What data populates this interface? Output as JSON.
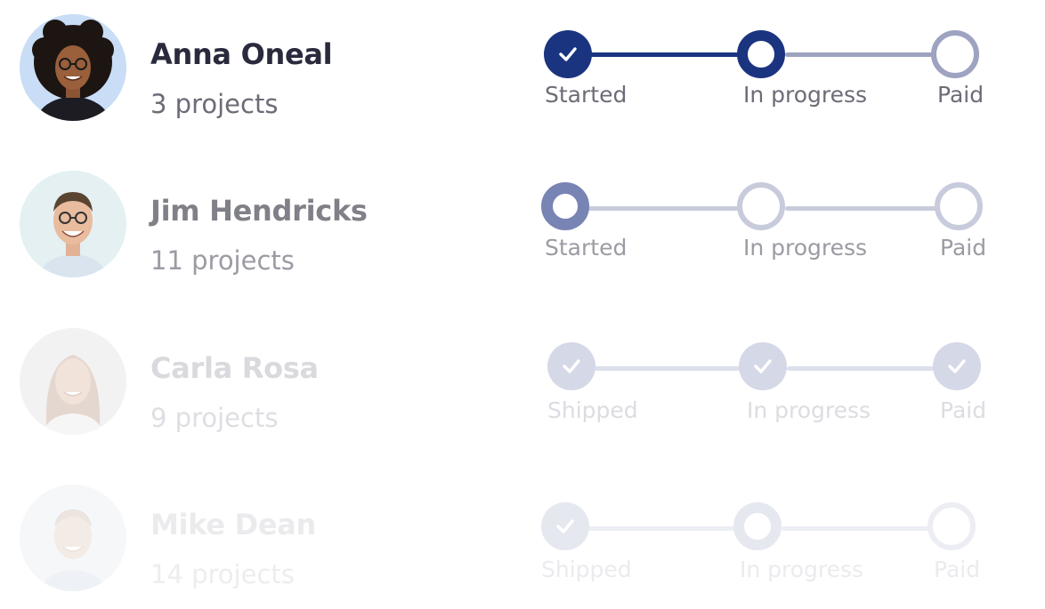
{
  "rows": [
    {
      "name": "Anna Oneal",
      "projects": "3 projects",
      "steps": [
        "Started",
        "In progress",
        "Paid"
      ],
      "avatar_icon": "avatar-woman-curly-hair",
      "colors": {
        "name": "#2a2a3d",
        "count": "#6c6c78",
        "label": "#6c6c78",
        "accent": "#1b3480",
        "track": "#9da3c0"
      }
    },
    {
      "name": "Jim Hendricks",
      "projects": "11 projects",
      "steps": [
        "Started",
        "In progress",
        "Paid"
      ],
      "avatar_icon": "avatar-man-glasses",
      "colors": {
        "name": "#808088",
        "count": "#9b9ba4",
        "label": "#9b9ba4",
        "accent": "#7884b3",
        "track": "#c7cbdc"
      }
    },
    {
      "name": "Carla Rosa",
      "projects": "9 projects",
      "steps": [
        "Shipped",
        "In progress",
        "Paid"
      ],
      "avatar_icon": "avatar-woman-long-hair",
      "colors": {
        "name": "#d9d9de",
        "count": "#dedee3",
        "label": "#dcdce2",
        "accent": "#d5d8e6",
        "track": "#dcdfec"
      }
    },
    {
      "name": "Mike Dean",
      "projects": "14 projects",
      "steps": [
        "Shipped",
        "In progress",
        "Paid"
      ],
      "avatar_icon": "avatar-man-smiling",
      "colors": {
        "name": "#ebebee",
        "count": "#ededf0",
        "label": "#ebebef",
        "accent": "#e6e8f0",
        "track": "#eceef4"
      }
    }
  ]
}
